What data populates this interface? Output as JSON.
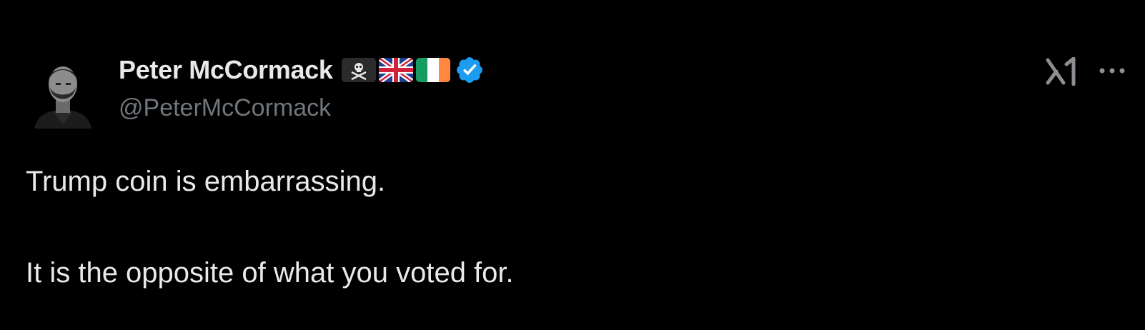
{
  "tweet": {
    "author": {
      "display_name": "Peter McCormack",
      "handle": "@PeterMcCormack",
      "name_emojis": [
        "pirate-flag-icon",
        "uk-flag-icon",
        "ireland-flag-icon"
      ],
      "verified": true
    },
    "text_lines": [
      "Trump coin is embarrassing.",
      "It is the opposite of what you voted for."
    ],
    "actions": {
      "grok_icon": "grok-icon",
      "more_icon": "more-icon"
    }
  },
  "colors": {
    "background": "#000000",
    "primary_text": "#e7e9ea",
    "secondary_text": "#71767b",
    "verified_blue": "#1d9bf0"
  }
}
